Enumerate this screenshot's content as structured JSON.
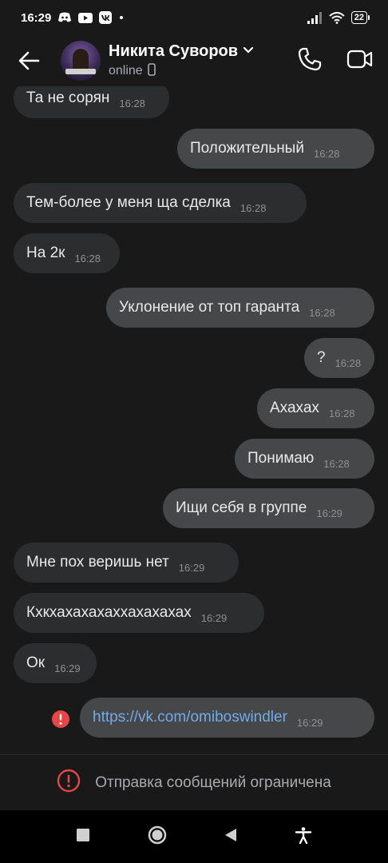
{
  "status": {
    "time": "16:29",
    "battery": "22",
    "icons": [
      "discord-icon",
      "youtube-icon",
      "vk-icon",
      "dot-icon",
      "signal-icon",
      "wifi-icon",
      "battery-icon"
    ]
  },
  "header": {
    "name": "Никита Суворов",
    "status": "online",
    "icons": [
      "back-arrow-icon",
      "chevron-down-icon",
      "mobile-device-icon",
      "phone-icon",
      "video-camera-icon"
    ]
  },
  "messages": [
    {
      "dir": "in",
      "text": "Та не сорян",
      "time": "16:28"
    },
    {
      "dir": "out",
      "text": "Положительный",
      "time": "16:28"
    },
    {
      "dir": "in",
      "text": "Тем-более у меня ща сделка",
      "time": "16:28"
    },
    {
      "dir": "in",
      "text": "На 2к",
      "time": "16:28"
    },
    {
      "dir": "out",
      "text": "Уклонение от топ гаранта",
      "time": "16:28"
    },
    {
      "dir": "out",
      "text": "?",
      "time": "16:28"
    },
    {
      "dir": "out",
      "text": "Ахахах",
      "time": "16:28"
    },
    {
      "dir": "out",
      "text": "Понимаю",
      "time": "16:28"
    },
    {
      "dir": "out",
      "text": "Ищи себя в группе",
      "time": "16:29"
    },
    {
      "dir": "in",
      "text": "Мне пох веришь нет",
      "time": "16:29"
    },
    {
      "dir": "in",
      "text": "Кхкхахахахаххахахахах",
      "time": "16:29"
    },
    {
      "dir": "in",
      "text": "Ок",
      "time": "16:29"
    },
    {
      "dir": "out",
      "text": "https://vk.com/omiboswindler",
      "time": "16:29",
      "failed": true
    }
  ],
  "composer": {
    "notice": "Отправка сообщений ограничена"
  },
  "colors": {
    "background": "#19191a",
    "incoming_bubble": "#2c2d2e",
    "outgoing_bubble": "#464749",
    "link": "#71aaeb",
    "error": "#e64646"
  },
  "navbar": {
    "icons": [
      "recent-apps-icon",
      "home-icon",
      "back-icon",
      "accessibility-icon"
    ]
  }
}
